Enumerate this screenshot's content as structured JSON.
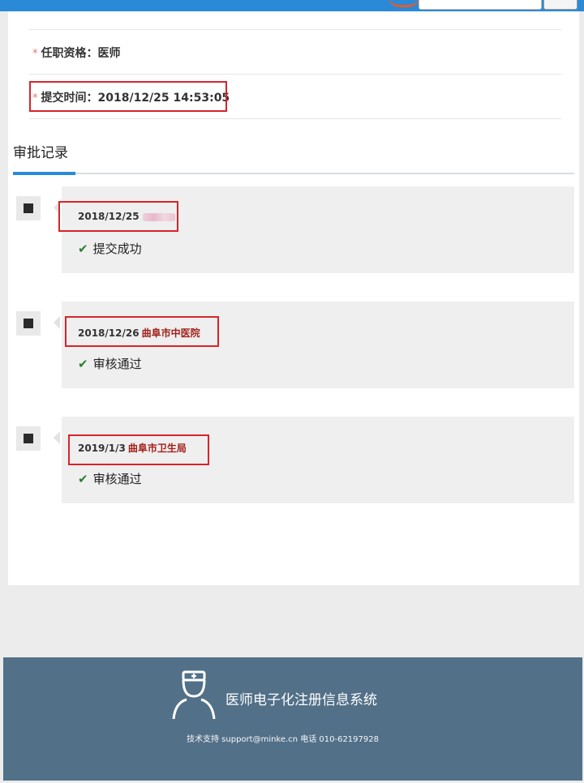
{
  "info": {
    "qualification_label": "任职资格：医师",
    "submit_time_label": "提交时间：2018/12/25 14:53:05"
  },
  "section": {
    "title": "审批记录"
  },
  "timeline": [
    {
      "date": "2018/12/25",
      "org": "",
      "status": "提交成功"
    },
    {
      "date": "2018/12/26",
      "org": "曲阜市中医院",
      "status": "审核通过"
    },
    {
      "date": "2019/1/3",
      "org": "曲阜市卫生局",
      "status": "审核通过"
    }
  ],
  "footer": {
    "system_name": "医师电子化注册信息系统",
    "support": "技术支持 support@minke.cn 电话 010-62197928"
  },
  "icons": {
    "check": "check-icon",
    "nurse": "nurse-icon",
    "marker": "timeline-marker-icon"
  },
  "colors": {
    "accent": "#2a8ad8",
    "highlight": "#d8232a",
    "org_text": "#a2201a",
    "footer_bg": "#527088",
    "success": "#2e7d32"
  }
}
